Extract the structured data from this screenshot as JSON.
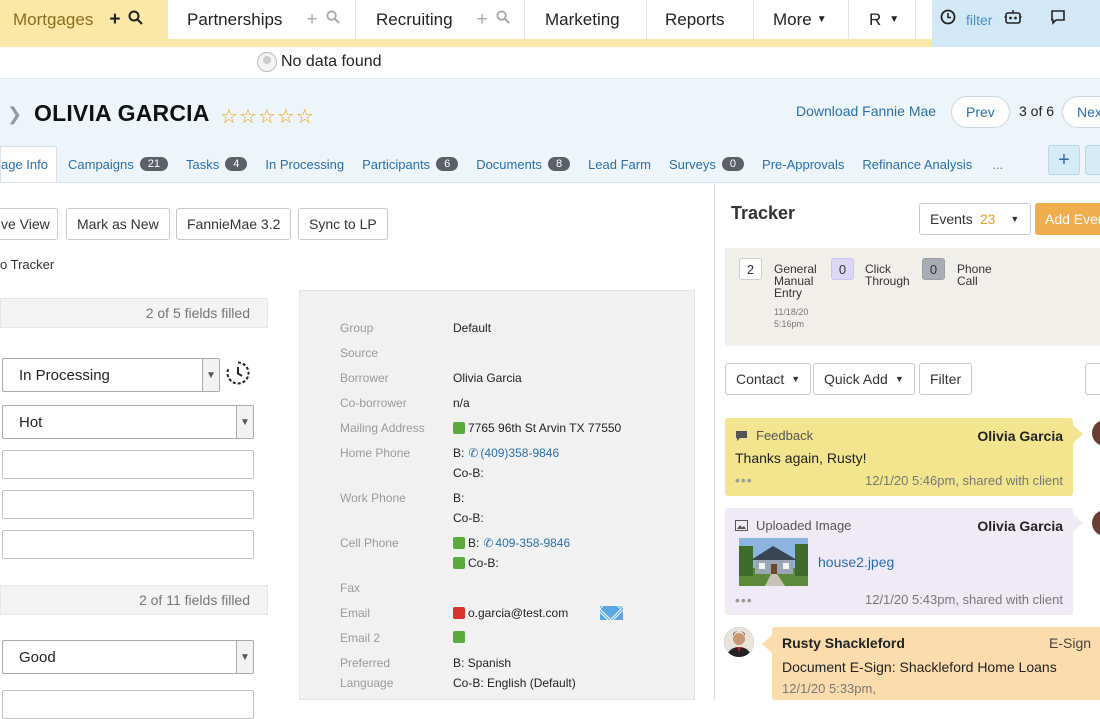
{
  "nav": {
    "tabs": [
      {
        "label": "Mortgages"
      },
      {
        "label": "Partnerships"
      },
      {
        "label": "Recruiting"
      },
      {
        "label": "Marketing"
      },
      {
        "label": "Reports"
      },
      {
        "label": "More"
      },
      {
        "label": "R"
      }
    ],
    "filter_label": "filter"
  },
  "notice": {
    "no_data": "No data found"
  },
  "contact": {
    "name": "OLIVIA GARCIA",
    "rating": 0,
    "rating_max": 5,
    "download_label": "Download Fannie Mae",
    "prev_label": "Prev",
    "position": "3 of 6",
    "next_label": "Next"
  },
  "tabs": [
    {
      "label": "age Info"
    },
    {
      "label": "Campaigns",
      "count": "21"
    },
    {
      "label": "Tasks",
      "count": "4"
    },
    {
      "label": "In Processing"
    },
    {
      "label": "Participants",
      "count": "6"
    },
    {
      "label": "Documents",
      "count": "8"
    },
    {
      "label": "Lead Farm"
    },
    {
      "label": "Surveys",
      "count": "0"
    },
    {
      "label": "Pre-Approvals"
    },
    {
      "label": "Refinance Analysis"
    },
    {
      "label": "..."
    }
  ],
  "actions": {
    "view": "ve View",
    "mark_new": "Mark as New",
    "fanniemae": "FannieMae 3.2",
    "sync": "Sync to LP",
    "tracker_link": "o Tracker",
    "plus": "+"
  },
  "form": {
    "section1_filled": "2 of 5 fields filled",
    "status": "In Processing",
    "temperature": "Hot",
    "section2_filled": "2 of 11 fields filled",
    "credit": "Good"
  },
  "details": {
    "group_label": "Group",
    "group": "Default",
    "source_label": "Source",
    "borrower_label": "Borrower",
    "borrower": "Olivia Garcia",
    "coborrower_label": "Co-borrower",
    "coborrower": "n/a",
    "mailing_label": "Mailing Address",
    "mailing": "7765 96th St Arvin TX 77550",
    "home_label": "Home Phone",
    "home_b": "B:",
    "home_b_num": "(409)358-9846",
    "home_cob": "Co-B:",
    "work_label": "Work Phone",
    "work_b": "B:",
    "work_cob": "Co-B:",
    "cell_label": "Cell Phone",
    "cell_b": "B:",
    "cell_b_num": "409-358-9846",
    "cell_cob": "Co-B:",
    "fax_label": "Fax",
    "email_label": "Email",
    "email": "o.garcia@test.com",
    "email2_label": "Email 2",
    "lang_label1": "Preferred",
    "lang_label2": "Language",
    "lang_b": "B: Spanish",
    "lang_cob": "Co-B: English (Default)"
  },
  "tracker": {
    "title": "Tracker",
    "events_label": "Events",
    "events_count": "23",
    "add_event": "Add Event",
    "counters": [
      {
        "count": "2",
        "label": "General Manual Entry",
        "date": "11/18/20",
        "time": "5:16pm"
      },
      {
        "count": "0",
        "label": "Click Through"
      },
      {
        "count": "0",
        "label": "Phone Call"
      }
    ],
    "contact_btn": "Contact",
    "quickadd_btn": "Quick Add",
    "filter_btn": "Filter",
    "feed": [
      {
        "type": "Feedback",
        "author": "Olivia Garcia",
        "text": "Thanks again, Rusty!",
        "meta": "12/1/20 5:46pm, shared with client"
      },
      {
        "type": "Uploaded Image",
        "author": "Olivia Garcia",
        "file": "house2.jpeg",
        "meta": "12/1/20 5:43pm, shared with client"
      },
      {
        "author": "Rusty Shackleford",
        "type": "E-Sign",
        "text": "Document E-Sign: Shackleford Home Loans",
        "meta": "12/1/20 5:33pm,"
      }
    ]
  },
  "colors": {
    "accent": "#2b6fa8",
    "nav_active": "#fbe8a6",
    "orange": "#f0ad4e",
    "feedback": "#f2e58d",
    "image_card": "#efeaf6",
    "esign": "#fbdcad"
  }
}
